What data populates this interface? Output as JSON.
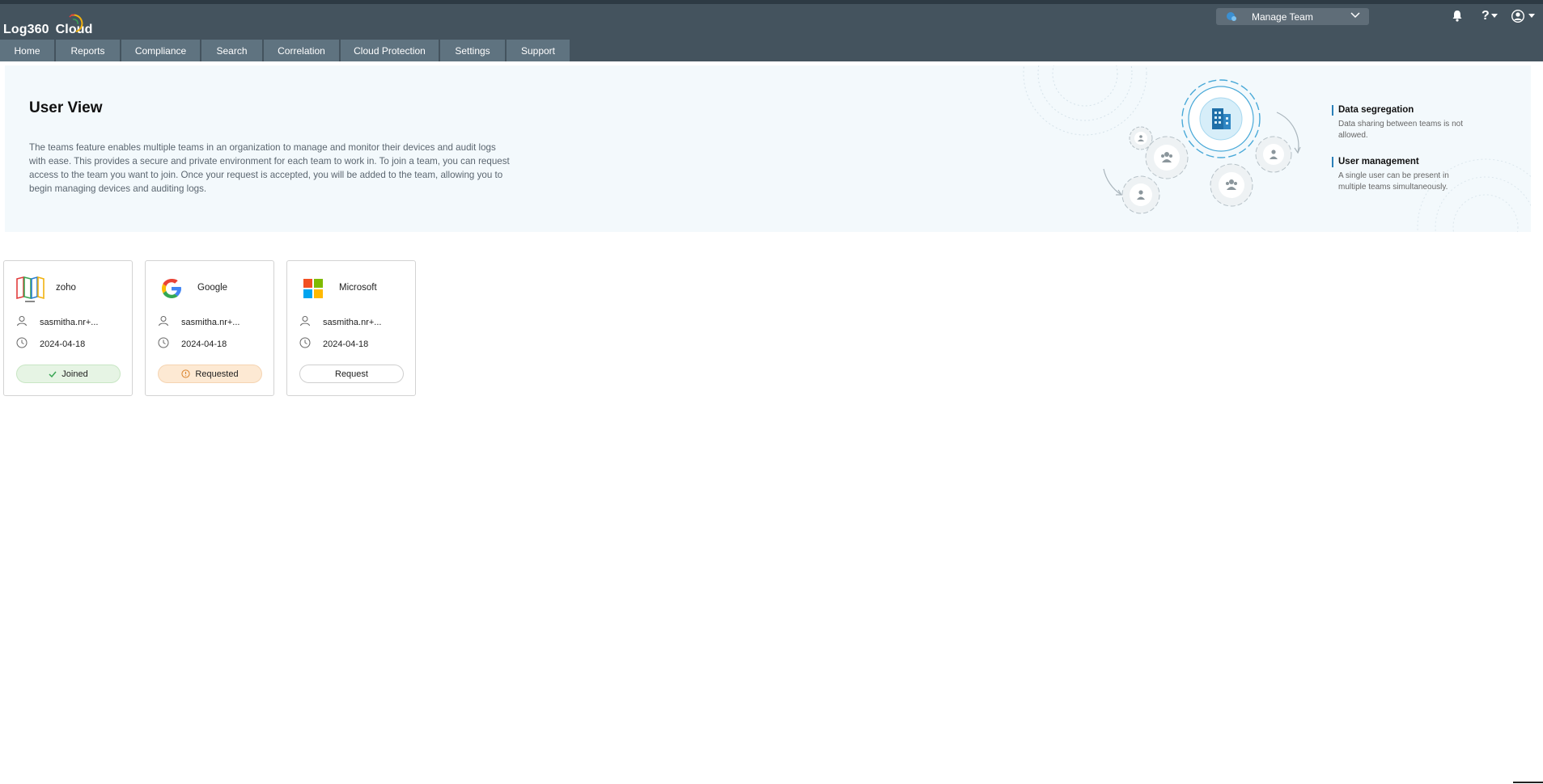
{
  "app": {
    "name": "Log360",
    "name_suffix": "Cloud"
  },
  "header": {
    "team_selector": {
      "label": "Manage Team"
    },
    "help_label": "?"
  },
  "nav": {
    "tabs": [
      {
        "label": "Home"
      },
      {
        "label": "Reports"
      },
      {
        "label": "Compliance"
      },
      {
        "label": "Search"
      },
      {
        "label": "Correlation"
      },
      {
        "label": "Cloud Protection"
      },
      {
        "label": "Settings"
      },
      {
        "label": "Support"
      }
    ]
  },
  "banner": {
    "title": "User View",
    "description": "The teams feature enables multiple teams in an organization to manage and monitor their devices and audit logs with ease. This provides a secure and private environment for each team to work in. To join a team, you can request access to the team you want to join. Once your request is accepted, you will be added to the team, allowing you to begin managing devices and auditing logs.",
    "features": [
      {
        "title": "Data segregation",
        "desc": "Data sharing between teams is not allowed."
      },
      {
        "title": "User management",
        "desc": "A single user can be present in multiple teams simultaneously."
      }
    ]
  },
  "teams": [
    {
      "name": "zoho",
      "user": "sasmitha.nr+...",
      "date": "2024-04-18",
      "status": "Joined",
      "logo": "zoho-logo"
    },
    {
      "name": "Google",
      "user": "sasmitha.nr+...",
      "date": "2024-04-18",
      "status": "Requested",
      "logo": "google-logo"
    },
    {
      "name": "Microsoft",
      "user": "sasmitha.nr+...",
      "date": "2024-04-18",
      "status": "Request",
      "logo": "microsoft-logo"
    }
  ],
  "colors": {
    "header_bg": "#44535e",
    "nav_tab_bg": "#5f7380",
    "banner_bg": "#f3f9fc",
    "joined_bg": "#e6f4e4",
    "requested_bg": "#fde9d3",
    "accent": "#2a7fb8"
  }
}
